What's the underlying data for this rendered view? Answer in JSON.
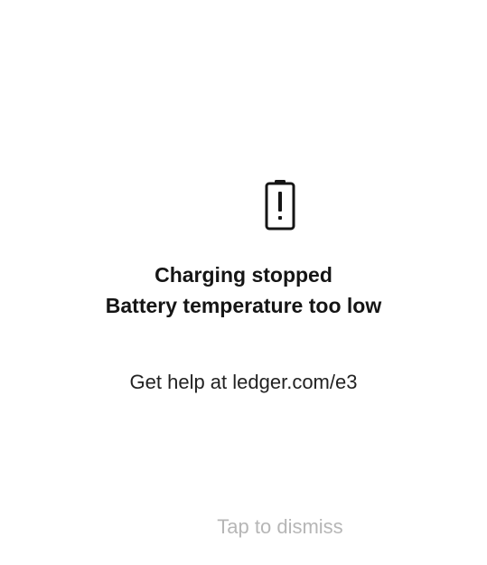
{
  "alert": {
    "icon": "battery-warning-icon",
    "title_line_1": "Charging stopped",
    "title_line_2": "Battery temperature too low",
    "help_text": "Get help at ledger.com/e3",
    "dismiss_label": "Tap to dismiss"
  },
  "colors": {
    "background": "#ffffff",
    "text": "#151515",
    "muted": "#b6b6b6"
  }
}
